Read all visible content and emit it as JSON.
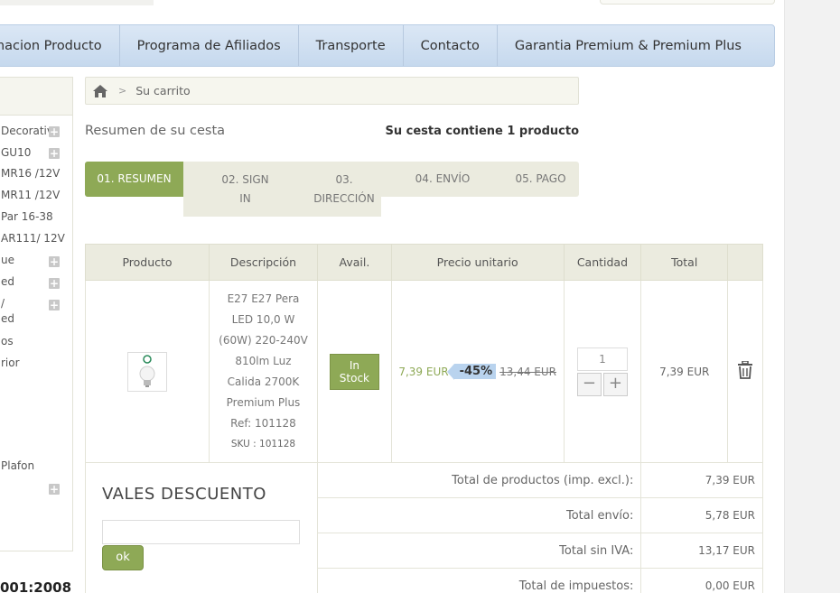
{
  "nav": {
    "items": [
      "macion Producto",
      "Programa de Afiliados",
      "Transporte",
      "Contacto",
      "Garantia Premium & Premium Plus"
    ]
  },
  "sidebar": {
    "items": [
      "Decorativa",
      "GU10",
      "MR16 /12V",
      "MR11 /12V",
      "Par 16-38",
      "AR111/ 12V",
      "ue",
      "ed",
      "/",
      "ed",
      "os",
      "rior",
      "Plafon"
    ],
    "footer_text": "001:2008"
  },
  "breadcrumb": {
    "separator": ">",
    "current": "Su carrito"
  },
  "summary": {
    "title": "Resumen de su cesta",
    "count_text": "Su cesta contiene 1 producto"
  },
  "steps": {
    "s1": "01. RESUMEN",
    "s2a": "02. SIGN",
    "s2b": "IN",
    "s3a": "03.",
    "s3b": "DIRECCIÓN",
    "s4": "04. ENVÍO",
    "s5": "05. PAGO"
  },
  "table": {
    "headers": {
      "producto": "Producto",
      "descripcion": "Descripción",
      "avail": "Avail.",
      "precio": "Precio unitario",
      "cantidad": "Cantidad",
      "total": "Total"
    },
    "item": {
      "desc_lines": [
        "E27 E27 Pera",
        "LED 10,0 W",
        "(60W) 220-240V",
        "810lm Luz",
        "Calida 2700K",
        "Premium Plus",
        "Ref: 101128"
      ],
      "sku": "SKU : 101128",
      "stock_line1": "In",
      "stock_line2": "Stock",
      "price_new": "7,39 EUR",
      "discount": "-45%",
      "price_old": "13,44 EUR",
      "quantity": "1",
      "total": "7,39 EUR"
    }
  },
  "totals": {
    "products_label": "Total de productos (imp. excl.):",
    "products_value": "7,39 EUR",
    "shipping_label": "Total envío:",
    "shipping_value": "5,78 EUR",
    "no_vat_label": "Total sin IVA:",
    "no_vat_value": "13,17 EUR",
    "tax_label": "Total de impuestos:",
    "tax_value": "0,00 EUR"
  },
  "vouchers": {
    "title": "VALES DESCUENTO",
    "input_value": "",
    "button_label": "ok"
  },
  "colors": {
    "accent_green": "#8ea956",
    "nav_blue": "#c6d9ee",
    "discount_blue": "#b9d3ee"
  }
}
